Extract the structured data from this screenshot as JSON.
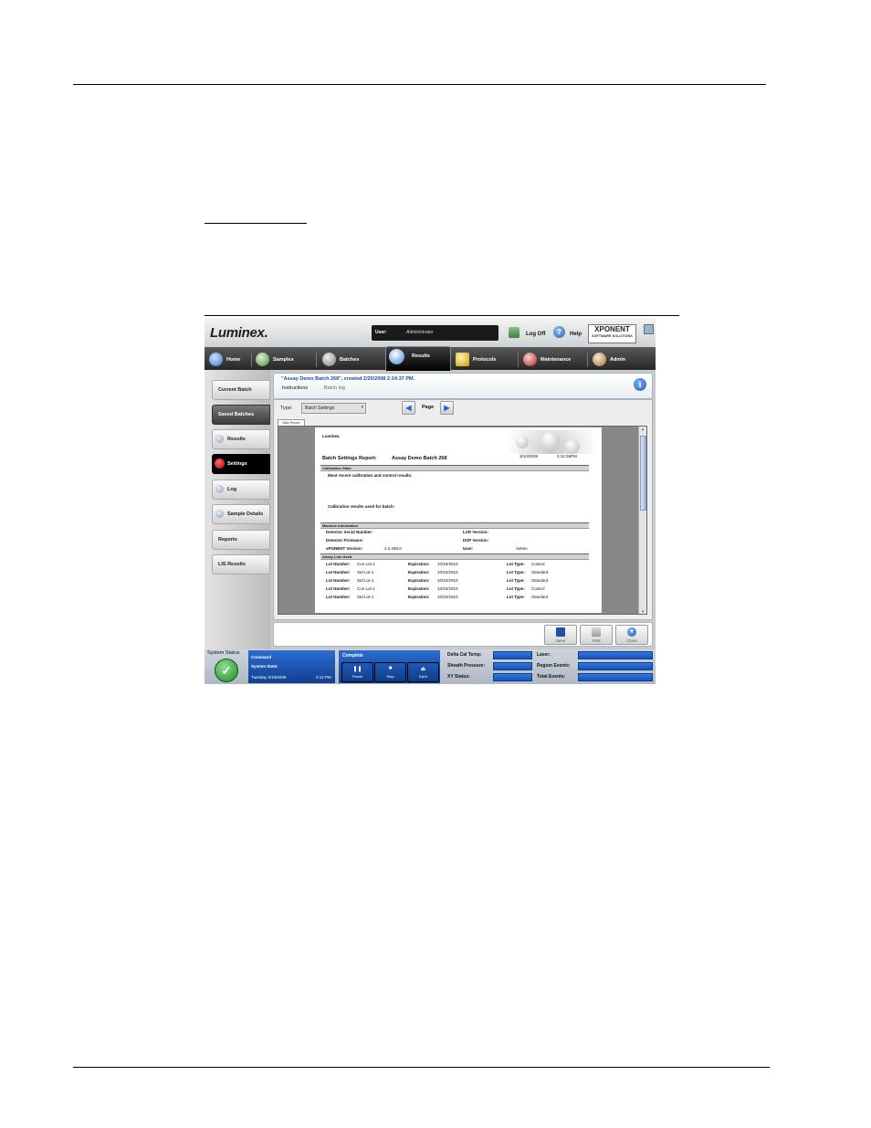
{
  "app": {
    "logo": "Luminex.",
    "user_label": "User:",
    "user_value": "Administrator",
    "logoff_label": "Log Off",
    "help_label": "Help",
    "product_logo": "XPONENT",
    "product_logo_sub": "SOFTWARE SOLUTIONS"
  },
  "nav": {
    "tabs": [
      {
        "label": "Home",
        "icon": "home-icon"
      },
      {
        "label": "Samples",
        "icon": "samples-icon"
      },
      {
        "label": "Batches",
        "icon": "batches-icon"
      },
      {
        "label": "Results",
        "icon": "results-icon",
        "active": true
      },
      {
        "label": "Protocols",
        "icon": "protocols-icon"
      },
      {
        "label": "Maintenance",
        "icon": "maintenance-icon"
      },
      {
        "label": "Admin",
        "icon": "admin-icon"
      }
    ]
  },
  "sidebar": {
    "items": [
      {
        "label": "Current Batch"
      },
      {
        "label": "Saved Batches",
        "selected": true
      },
      {
        "label": "Results"
      },
      {
        "label": "Settings",
        "active": true
      },
      {
        "label": "Log"
      },
      {
        "label": "Sample Details"
      },
      {
        "label": "Reports"
      },
      {
        "label": "LIS Results"
      }
    ]
  },
  "panel": {
    "title": "\"Assay Demo Batch 268\", created 2/25/2008 2:14:37 PM.",
    "tab_instructions": "Instructions",
    "tab_batchlog": "Batch log"
  },
  "report_toolbar": {
    "type_label": "Type:",
    "type_value": "Batch Settings",
    "page_label": "Page",
    "main_tab": "Main Report"
  },
  "report": {
    "brand": "Luminex.",
    "title": "Batch Settings Report:",
    "batch_name": "Assay Demo Batch 268",
    "date": "3/10/2008",
    "time": "3:12:36PM",
    "sections": {
      "calibration": "Calibration State",
      "machine": "Machine Information",
      "lots": "Assay Lots Used"
    },
    "calibration_line1": "Most recent calibration and control results:",
    "calibration_line2": "Calibration results used for batch:",
    "machine": {
      "serial_label": "Detector Serial Number:",
      "firmware_label": "Detector Firmware:",
      "xponent_label": "xPONENT Version:",
      "xponent_value": "4.0.298.0",
      "lxr_label": "LXR Version:",
      "dsp_label": "DSP Version:",
      "user_label": "User:",
      "user_value": "Admin"
    },
    "lot_labels": {
      "number": "Lot Number:",
      "expiration": "Expiration:",
      "type": "Lot Type:"
    },
    "lots": [
      {
        "number": "Con Lot-1",
        "expiration": "10/10/2010",
        "type": "Control"
      },
      {
        "number": "Std Lot-1",
        "expiration": "10/10/2010",
        "type": "Standard"
      },
      {
        "number": "Std Lot-1",
        "expiration": "10/10/2010",
        "type": "Standard"
      },
      {
        "number": "Con Lot-1",
        "expiration": "10/10/2010",
        "type": "Control"
      },
      {
        "number": "Std Lot-1",
        "expiration": "10/10/2010",
        "type": "Standard"
      }
    ]
  },
  "bottom_buttons": {
    "save": "Save",
    "print": "Print",
    "close": "Close"
  },
  "status": {
    "system_status_label": "System Status",
    "command_label": "Command",
    "system_state_label": "System State:",
    "date_text": "Tuesday 3/10/2008",
    "time_text": "3:12 PM",
    "complete_label": "Complete",
    "pause": "Pause",
    "stop": "Stop",
    "eject": "Eject",
    "delta_cal_temp": "Delta Cal Temp:",
    "sheath_pressure": "Sheath Pressure:",
    "xy_status": "XY Status:",
    "laser": "Laser:",
    "region_events": "Region Events:",
    "total_events": "Total Events:"
  },
  "colors": {
    "accent_blue": "#1f67d3",
    "status_ok": "#1d8a24",
    "settings_red": "#c00000"
  }
}
